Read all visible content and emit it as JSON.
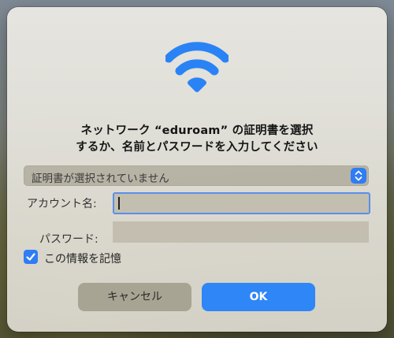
{
  "dialog": {
    "title_line1": "ネットワーク “eduroam” の証明書を選択",
    "title_line2": "するか、名前とパスワードを入力してください",
    "certificate": {
      "selected": "証明書が選択されていません"
    },
    "account_label": "アカウント名:",
    "account_value": "",
    "password_label": "パスワード:",
    "password_value": "",
    "remember": {
      "label": "この情報を記憶",
      "checked": true
    },
    "buttons": {
      "cancel": "キャンセル",
      "ok": "OK"
    }
  },
  "icons": {
    "network": "wifi-icon",
    "select": "chevron-up-down-icon",
    "checkbox": "checkmark-icon"
  },
  "colors": {
    "accent": "#2f86f6",
    "wifi": "#2a83f5",
    "focus_ring": "#5b8ee8"
  }
}
